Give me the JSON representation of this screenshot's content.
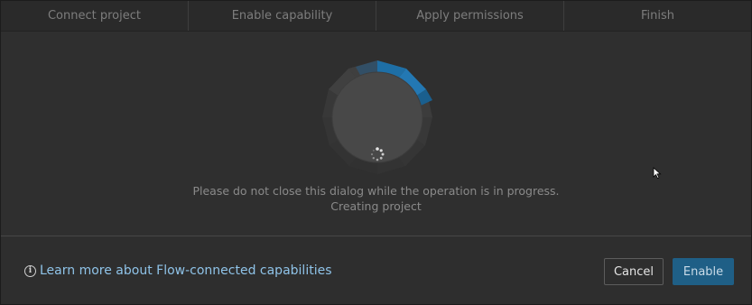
{
  "steps": [
    {
      "label": "Connect project"
    },
    {
      "label": "Enable capability"
    },
    {
      "label": "Apply permissions"
    },
    {
      "label": "Finish"
    }
  ],
  "progress": {
    "message": "Please do not close this dialog while the operation is in progress.",
    "status": "Creating project",
    "spinner_icon": "loading-spinner-icon",
    "accent_color": "#1e6fa6"
  },
  "footer": {
    "info_icon": "info-icon",
    "learn_more": "Learn more about Flow-connected capabilities",
    "cancel_label": "Cancel",
    "enable_label": "Enable"
  },
  "colors": {
    "background": "#2e2e2e",
    "link": "#8fc3e8",
    "primary_button": "#1f5f86"
  }
}
